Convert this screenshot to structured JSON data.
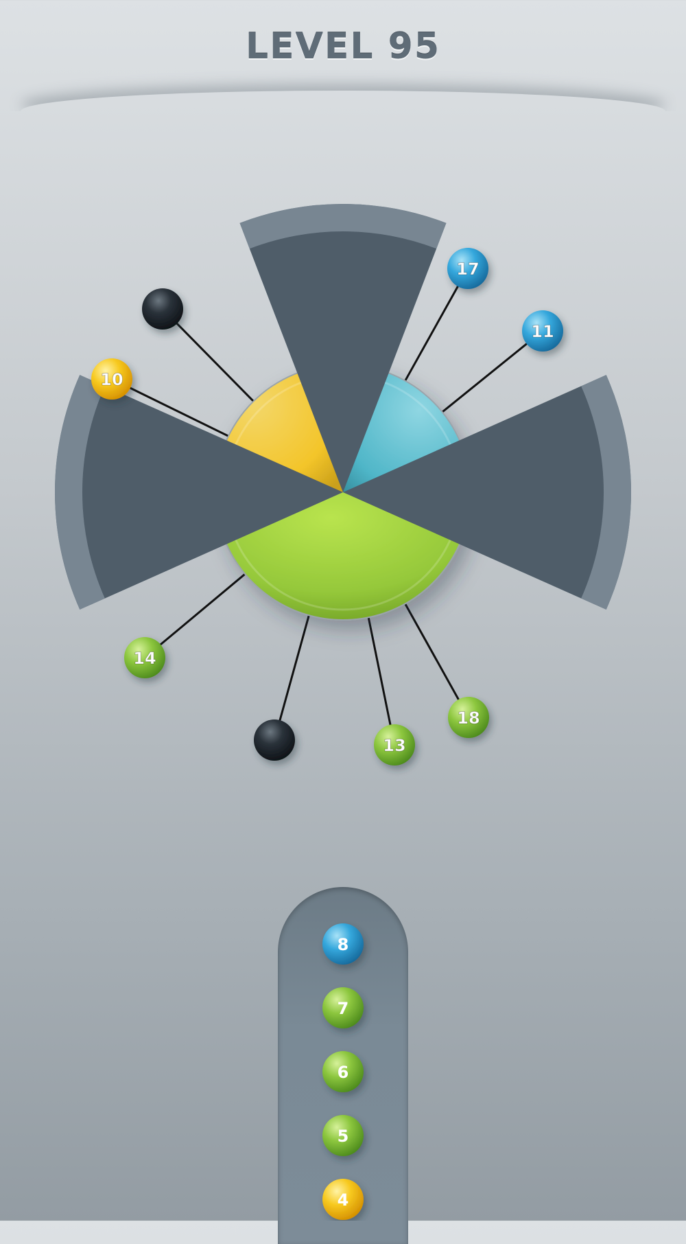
{
  "level": {
    "title": "LEVEL 95"
  },
  "palette": {
    "yellow": "#f5c21d",
    "teal": "#4fb6c8",
    "green": "#8cc63e",
    "blue": "#2a9dd6",
    "black": "#1d232a",
    "blocker": "#546370",
    "queue": "#7a8a96"
  },
  "wheel": {
    "segments": [
      {
        "color": "yellow"
      },
      {
        "color": "teal"
      },
      {
        "color": "green"
      },
      {
        "color": "teal"
      }
    ]
  },
  "pins": [
    {
      "color": "black",
      "label": ""
    },
    {
      "color": "yellow",
      "label": "10"
    },
    {
      "color": "blue",
      "label": "17"
    },
    {
      "color": "blue",
      "label": "11"
    },
    {
      "color": "green",
      "label": "14"
    },
    {
      "color": "black",
      "label": ""
    },
    {
      "color": "green",
      "label": "13"
    },
    {
      "color": "green",
      "label": "18"
    }
  ],
  "queue": {
    "balls": [
      {
        "color": "blue",
        "label": "8"
      },
      {
        "color": "green",
        "label": "7"
      },
      {
        "color": "green",
        "label": "6"
      },
      {
        "color": "green",
        "label": "5"
      },
      {
        "color": "yellow",
        "label": "4"
      }
    ]
  }
}
